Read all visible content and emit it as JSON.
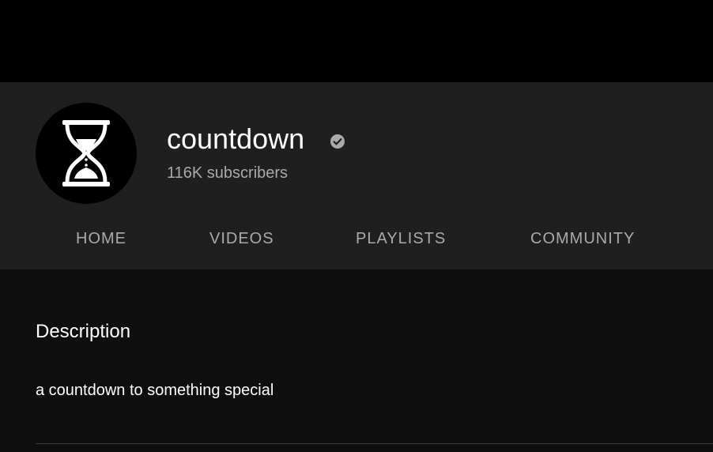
{
  "channel": {
    "name": "countdown",
    "subscribers": "116K subscribers",
    "verified": true,
    "avatar_icon": "hourglass-icon",
    "verified_icon": "verified-check-icon"
  },
  "tabs": [
    {
      "label": "HOME"
    },
    {
      "label": "VIDEOS"
    },
    {
      "label": "PLAYLISTS"
    },
    {
      "label": "COMMUNITY"
    }
  ],
  "about": {
    "heading": "Description",
    "text": "a countdown to something special"
  },
  "colors": {
    "top_bar": "#000000",
    "header_bg": "#1f1f1f",
    "page_bg": "#0f0f0f",
    "text_primary": "#ffffff",
    "text_secondary": "#aaaaaa"
  }
}
